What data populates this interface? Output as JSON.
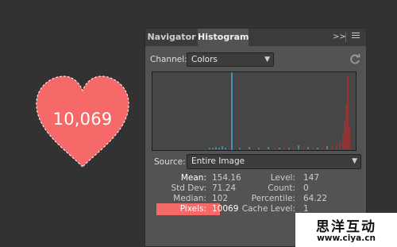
{
  "heart": {
    "label": "10,069",
    "color": "#f56969"
  },
  "panel": {
    "tabs": [
      "Navigator",
      "Histogram"
    ],
    "active_tab": "Histogram",
    "expand_glyph": ">>",
    "channel": {
      "label": "Channel:",
      "value": "Colors"
    },
    "source": {
      "label": "Source:",
      "value": "Entire Image"
    },
    "stats": {
      "mean": {
        "label": "Mean:",
        "value": "154.16"
      },
      "std_dev": {
        "label": "Std Dev:",
        "value": "71.24"
      },
      "median": {
        "label": "Median:",
        "value": "102"
      },
      "pixels": {
        "label": "Pixels:",
        "value": "10069"
      },
      "level": {
        "label": "Level:",
        "value": "147"
      },
      "count": {
        "label": "Count:",
        "value": "0"
      },
      "percentile": {
        "label": "Percentile:",
        "value": "64.22"
      },
      "cache_level": {
        "label": "Cache Level:",
        "value": "1"
      }
    },
    "colors": {
      "background": "#535353",
      "graph_background": "#464646",
      "highlight": "#f56969",
      "cursor_line": "#3fc8ff",
      "red_channel": "#e02020"
    }
  },
  "watermark": {
    "title": "思洋互动",
    "url": "www.ciya.cn"
  }
}
